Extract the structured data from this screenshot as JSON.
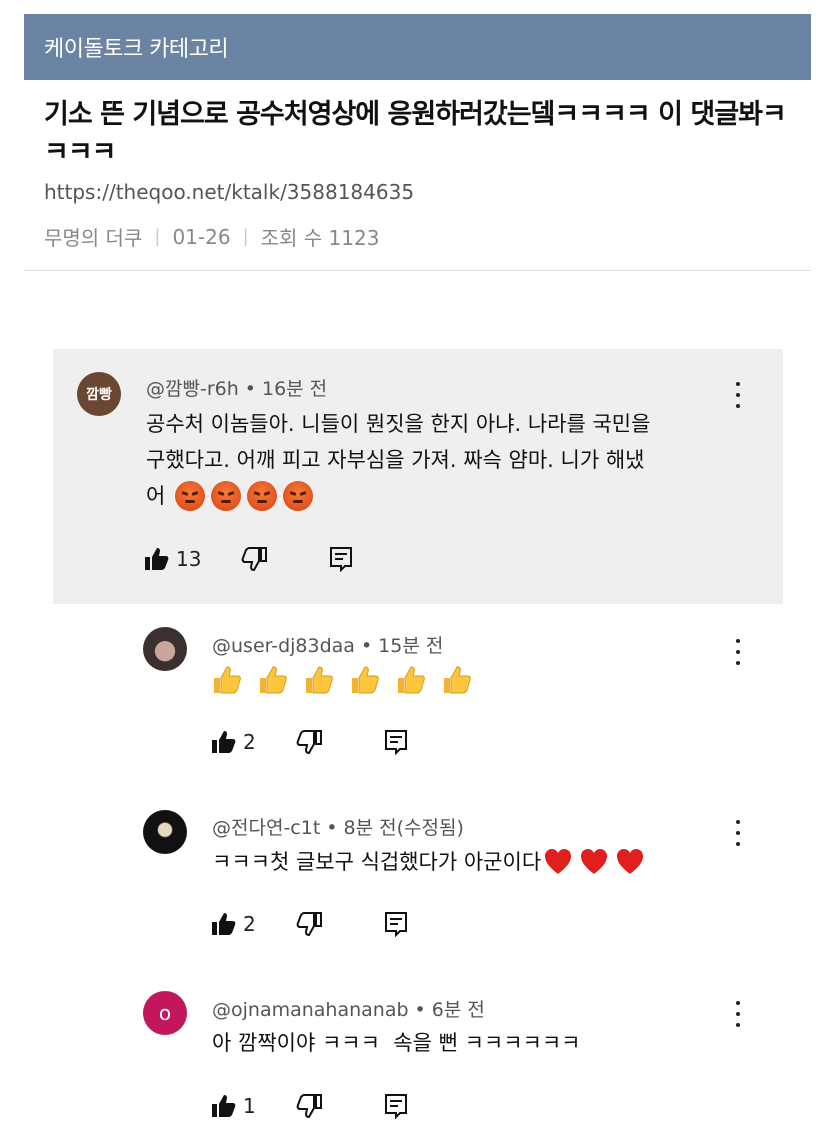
{
  "category": "케이돌토크 카테고리",
  "post": {
    "title": "기소 뜬 기념으로 공수처영상에 응원하러갔는뎈ㅋㅋㅋㅋ 이 댓글봐ㅋㅋㅋㅋ",
    "url": "https://theqoo.net/ktalk/3588184635",
    "author": "무명의 더쿠",
    "date": "01-26",
    "views": "조회 수 1123"
  },
  "comments": [
    {
      "avatar_text": "깜빵",
      "avatar_color": "#6b4632",
      "handle": "@깜빵-r6h",
      "time": "16분 전",
      "text_lines": [
        "공수처 이놈들아. 니들이 뭔짓을 한지 아냐. 나라를 국민을",
        "구했다고. 어깨 피고 자부심을 가져. 짜슥 얌마. 니가 해냈",
        "어"
      ],
      "emoji": "angry-face x4",
      "likes": "13"
    },
    {
      "avatar_color": "#3a3030",
      "handle": "@user-dj83daa",
      "time": "15분 전",
      "emoji": "thumbs-up x6",
      "likes": "2"
    },
    {
      "avatar_color": "#111111",
      "handle": "@전다연-c1t",
      "time": "8분 전(수정됨)",
      "text": "ㅋㅋㅋ첫 글보구 식겁했다가 아군이다",
      "emoji": "red-heart x3",
      "likes": "2"
    },
    {
      "avatar_text": "o",
      "avatar_color": "#c2185b",
      "handle": "@ojnamanahananab",
      "time": "6분 전",
      "text": "아 깜짝이야 ㅋㅋㅋ  속을 뻔 ㅋㅋㅋㅋㅋㅋ",
      "likes": "1"
    }
  ]
}
